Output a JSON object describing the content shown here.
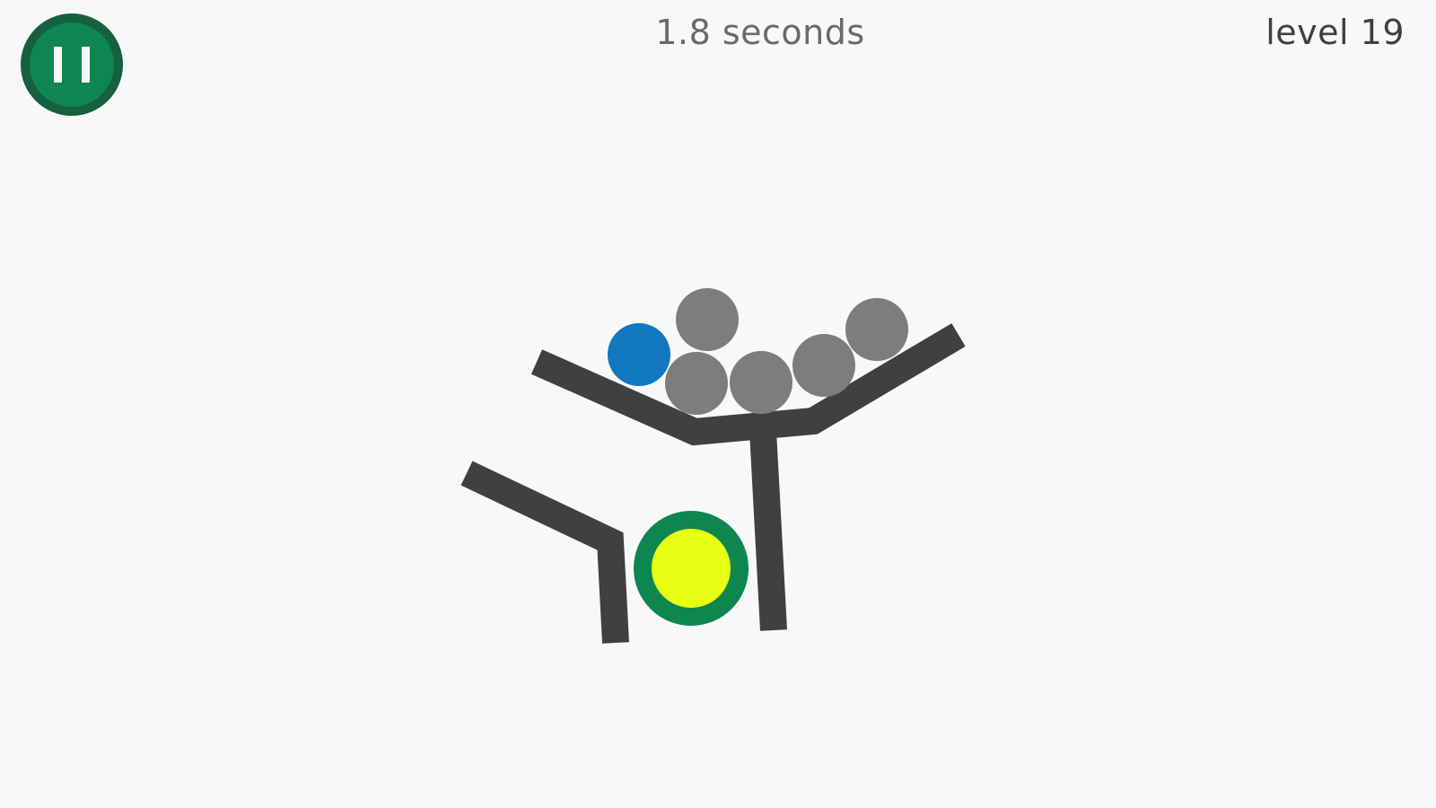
{
  "hud": {
    "timer_text": "1.8 seconds",
    "level_text": "level 19",
    "pause_icon": "pause-icon"
  },
  "colors": {
    "background": "#f8f8f8",
    "pause_outer": "#15613f",
    "pause_inner": "#0f8552",
    "wall": "#404040",
    "gray_ball": "#7d7d7d",
    "blue_ball": "#1178c0",
    "goal_ring": "#0e8650",
    "goal_center": "#e7ff12"
  }
}
